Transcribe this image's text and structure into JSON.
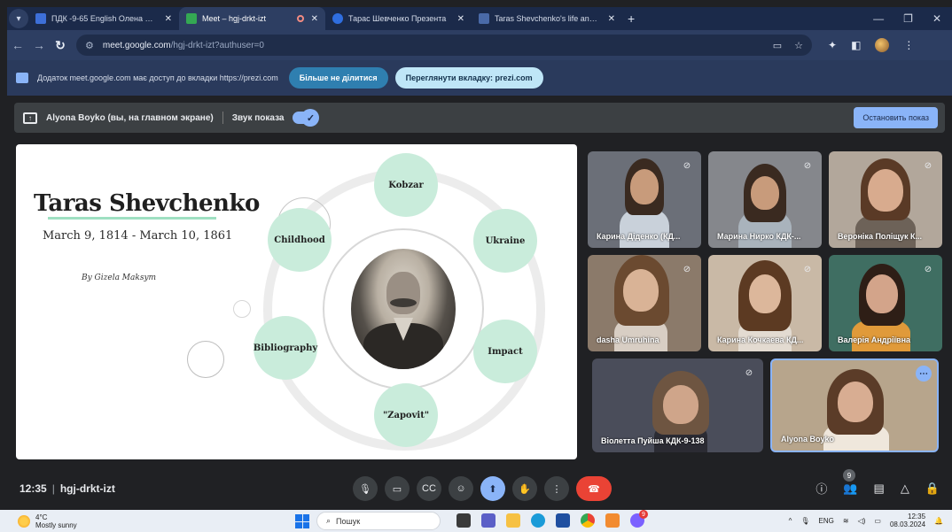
{
  "browser": {
    "tabs": [
      {
        "label": "ПДК -9-65 English Олена Олек",
        "fav": "#3d6fd8",
        "active": false
      },
      {
        "label": "Meet – hgj-drkt-izt",
        "fav": "#34a853",
        "active": true
      },
      {
        "label": "Тарас Шевченко Презента",
        "fav": "#2f6ee0",
        "active": false
      },
      {
        "label": "Taras Shevchenko's life and cre",
        "fav": "#4a6aa8",
        "active": false
      }
    ],
    "new_tab": "+",
    "url_host": "meet.google.com",
    "url_path": "/hgj-drkt-izt?authuser=0"
  },
  "infobar": {
    "message": "Додаток meet.google.com має доступ до вкладки https://prezi.com",
    "stop_sharing": "Більше не ділитися",
    "view_tab": "Переглянути вкладку: prezi.com"
  },
  "presenting": {
    "text": "Alyona Boyko (вы, на главном экране)",
    "audio_label": "Звук показа",
    "stop_button": "Остановить показ"
  },
  "slide": {
    "title": "Taras Shevchenko",
    "dates": "March 9, 1814 - March 10, 1861",
    "author": "By Gizela Maksym",
    "nodes": [
      "Kobzar",
      "Ukraine",
      "Impact",
      "\"Zapovit\"",
      "Bibliography",
      "Childhood"
    ]
  },
  "participants": [
    {
      "name": "Карина Діденко (КД..."
    },
    {
      "name": "Марина Нирко КДК-..."
    },
    {
      "name": "Вероніка Поліщук К..."
    },
    {
      "name": "dasha Umruhina"
    },
    {
      "name": "Карина Кочкаева КД..."
    },
    {
      "name": "Валерія Андріївна"
    },
    {
      "name": "Віолетта Пуйша КДК-9-138"
    },
    {
      "name": "Alyona Boyko"
    }
  ],
  "bottom": {
    "time": "12:35",
    "meeting_code": "hgj-drkt-izt",
    "people_count": "9"
  },
  "taskbar": {
    "temperature": "4°C",
    "weather": "Mostly sunny",
    "search_placeholder": "Пошук",
    "lang": "ENG",
    "time": "12:35",
    "date": "08.03.2024",
    "notif_badge": "9"
  }
}
